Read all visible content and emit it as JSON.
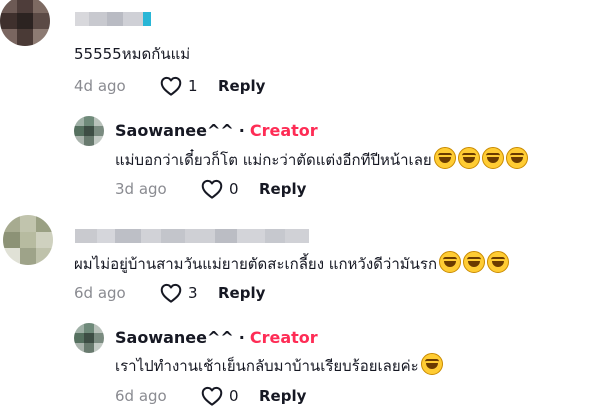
{
  "comments": [
    {
      "username": "",
      "text": "55555หมดกันแม่",
      "time": "4d ago",
      "likes": "1",
      "reply_label": "Reply",
      "reply": {
        "username": "Saowanee^^",
        "separator": "·",
        "badge": "Creator",
        "text": "แม่บอกว่าเดี๋ยวก็โต แม่กะว่าตัดแต่งอีกทีปีหน้าเลย",
        "emoji_count": 4,
        "time": "3d ago",
        "likes": "0",
        "reply_label": "Reply"
      }
    },
    {
      "username": "",
      "text": "ผมไม่อยู่บ้านสามวันแม่ยายตัดสะเกลี้ยง แกหวังดีว่ามันรก",
      "emoji_count": 3,
      "time": "6d ago",
      "likes": "3",
      "reply_label": "Reply",
      "reply": {
        "username": "Saowanee^^",
        "separator": "·",
        "badge": "Creator",
        "text": "เราไปทำงานเช้าเย็นกลับมาบ้านเรียบร้อยเลยค่ะ",
        "emoji_count": 1,
        "time": "6d ago",
        "likes": "0",
        "reply_label": "Reply"
      }
    }
  ],
  "colors": {
    "creator": "#fe2c55",
    "meta": "#8a8b91",
    "text": "#161823"
  },
  "icons": {
    "like": "heart-outline-icon",
    "laugh": "laughing-tears-emoji"
  }
}
